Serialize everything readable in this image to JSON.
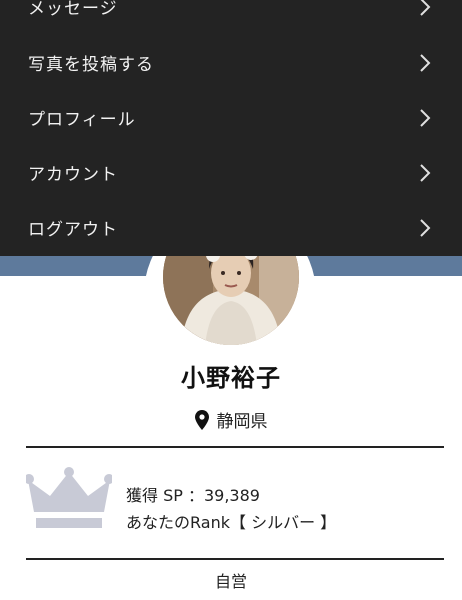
{
  "menu": {
    "items": [
      {
        "label": "メッセージ",
        "icon": "chevron-right-icon"
      },
      {
        "label": "写真を投稿する",
        "icon": "chevron-right-icon"
      },
      {
        "label": "プロフィール",
        "icon": "chevron-right-icon"
      },
      {
        "label": "アカウント",
        "icon": "chevron-right-icon"
      },
      {
        "label": "ログアウト",
        "icon": "chevron-right-icon"
      }
    ]
  },
  "profile": {
    "name": "小野裕子",
    "location": "静岡県",
    "location_icon": "map-pin-icon",
    "sp_text": "獲得 SP ：39,389",
    "rank_text": "あなたのRank【 シルバー 】",
    "rank_icon": "crown-icon",
    "occupation": "自営"
  },
  "colors": {
    "menu_bg": "#232323",
    "menu_text": "#f2f2f2",
    "cover": "#5e7a9c",
    "crown_silver": "#c8cad6"
  }
}
